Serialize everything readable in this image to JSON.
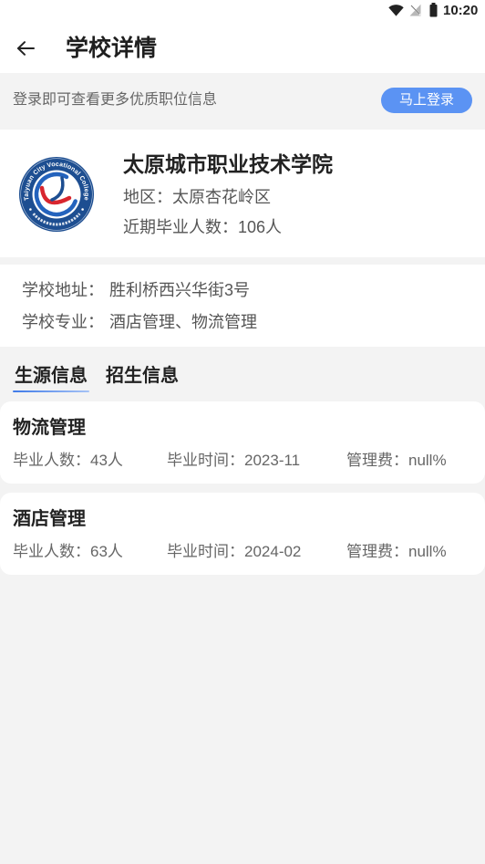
{
  "status_bar": {
    "time": "10:20",
    "icons": [
      "wifi-icon",
      "no-sim-signal-icon",
      "battery-icon"
    ]
  },
  "header": {
    "back_icon": "arrow-left-icon",
    "title": "学校详情"
  },
  "login_banner": {
    "text": "登录即可查看更多优质职位信息",
    "button_label": "马上登录"
  },
  "school": {
    "logo_text": "Taiyuan City Vocational College",
    "name": "太原城市职业技术学院",
    "region_label": "地区：",
    "region": "太原杏花岭区",
    "graduates_label": "近期毕业人数：",
    "graduates": "106人"
  },
  "details": {
    "address_label": "学校地址：",
    "address": "胜利桥西兴华街3号",
    "majors_label": "学校专业：",
    "majors": "酒店管理、物流管理"
  },
  "tabs": [
    {
      "label": "生源信息",
      "active": true
    },
    {
      "label": "招生信息",
      "active": false
    }
  ],
  "majors_list": [
    {
      "name": "物流管理",
      "graduates_label": "毕业人数：",
      "graduates": "43人",
      "time_label": "毕业时间：",
      "time": "2023-11",
      "fee_label": "管理费：",
      "fee": "null%"
    },
    {
      "name": "酒店管理",
      "graduates_label": "毕业人数：",
      "graduates": "63人",
      "time_label": "毕业时间：",
      "time": "2024-02",
      "fee_label": "管理费：",
      "fee": "null%"
    }
  ],
  "colors": {
    "accent": "#5b93f3",
    "page_background": "#f3f3f3",
    "card_background": "#ffffff",
    "text_primary": "#1f1f1f",
    "text_secondary": "#555555",
    "text_muted": "#666666",
    "logo_blue": "#1d4e91",
    "logo_red": "#d8262f",
    "tab_underline": "#3f7ae8"
  }
}
